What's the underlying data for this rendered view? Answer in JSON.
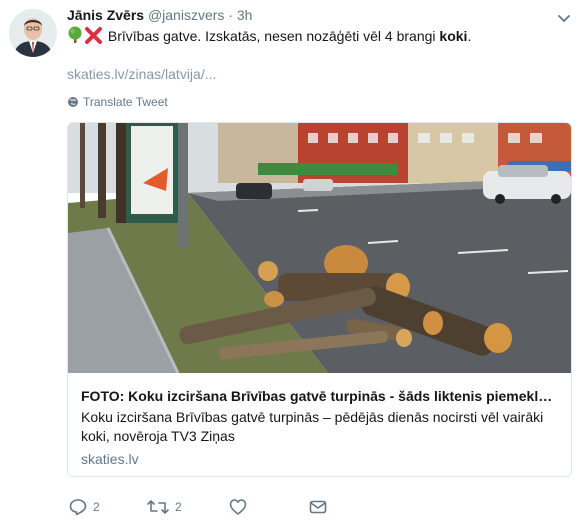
{
  "author": {
    "name": "Jānis Zvērs",
    "handle": "@janiszvers",
    "separator": "·",
    "time": "3h"
  },
  "tweet": {
    "text_before": "Brīvības gatve. Izskatās, nesen nozāģēti vēl 4 brangi ",
    "text_bold": "koki",
    "text_after": ".",
    "emojis": [
      "deciduous-tree-icon",
      "cross-mark-icon"
    ],
    "link": "skaties.lv/zinas/latvija/..."
  },
  "translate_label": "Translate Tweet",
  "card": {
    "title": "FOTO: Koku izciršana Brīvības gatvē turpinās - šāds liktenis piemeklējis vēl vairākus kokus",
    "description": "Koku izciršana Brīvības gatvē turpinās – pēdējās dienās nocirsti vēl vairāki koki, novēroja TV3 Ziņas",
    "domain": "skaties.lv"
  },
  "actions": {
    "reply_count": "2",
    "retweet_count": "2",
    "like_count": "",
    "icons": [
      "reply-icon",
      "retweet-icon",
      "like-icon",
      "dm-icon"
    ]
  },
  "colors": {
    "text": "#14171a",
    "secondary": "#657786",
    "link_muted": "#8899a6",
    "border": "#e1e8ed",
    "tree_green": "#4caf50",
    "cross_red": "#dd2e44"
  }
}
